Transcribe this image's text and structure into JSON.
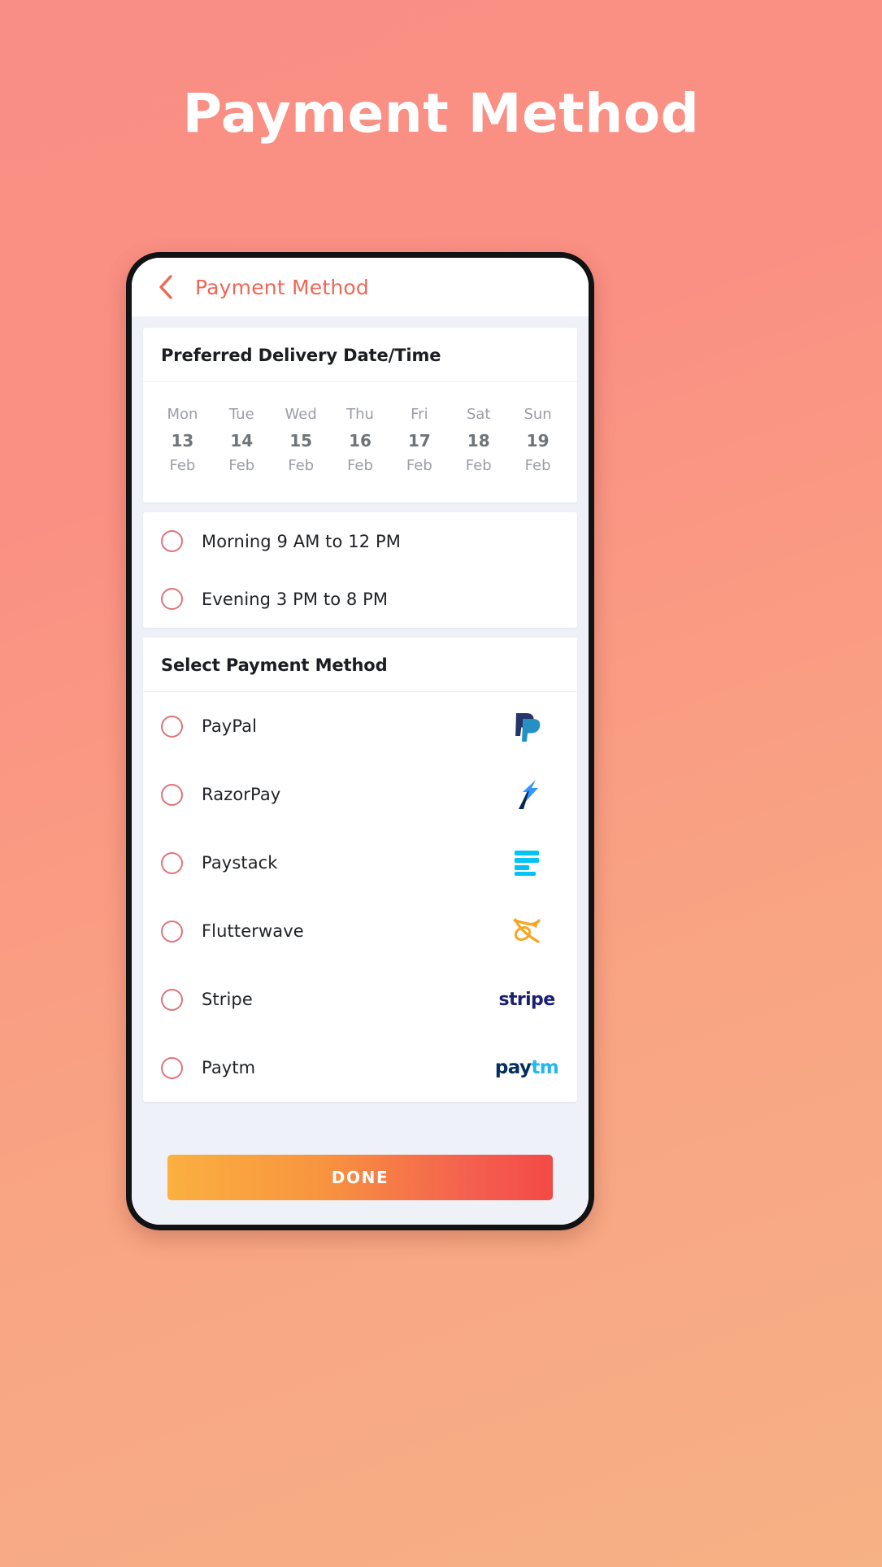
{
  "banner": {
    "title": "Payment Method"
  },
  "appbar": {
    "title": "Payment Method",
    "back_icon": "chevron-left-icon",
    "accent_color": "#ef6755"
  },
  "delivery_card": {
    "header": "Preferred Delivery Date/Time",
    "dates": [
      {
        "dow": "Mon",
        "day": "13",
        "month": "Feb"
      },
      {
        "dow": "Tue",
        "day": "14",
        "month": "Feb"
      },
      {
        "dow": "Wed",
        "day": "15",
        "month": "Feb"
      },
      {
        "dow": "Thu",
        "day": "16",
        "month": "Feb"
      },
      {
        "dow": "Fri",
        "day": "17",
        "month": "Feb"
      },
      {
        "dow": "Sat",
        "day": "18",
        "month": "Feb"
      },
      {
        "dow": "Sun",
        "day": "19",
        "month": "Feb"
      }
    ],
    "time_slots": [
      {
        "label": "Morning 9 AM to 12 PM",
        "selected": false
      },
      {
        "label": "Evening 3 PM to 8 PM",
        "selected": false
      }
    ]
  },
  "payment_card": {
    "header": "Select Payment Method",
    "methods": [
      {
        "label": "PayPal",
        "logo": "paypal-logo",
        "selected": false
      },
      {
        "label": "RazorPay",
        "logo": "razorpay-logo",
        "selected": false
      },
      {
        "label": "Paystack",
        "logo": "paystack-logo",
        "selected": false
      },
      {
        "label": "Flutterwave",
        "logo": "flutterwave-logo",
        "selected": false
      },
      {
        "label": "Stripe",
        "logo": "stripe-logo",
        "selected": false
      },
      {
        "label": "Paytm",
        "logo": "paytm-logo",
        "selected": false
      }
    ]
  },
  "footer": {
    "done_label": "DONE"
  },
  "logo_text": {
    "stripe": "stripe",
    "paytm_pay": "pay",
    "paytm_tm": "tm"
  },
  "colors": {
    "accent": "#ef6755",
    "radio_border": "#e0737a",
    "page_bg_top": "#f98f84",
    "page_bg_bottom": "#f6b184",
    "screen_bg": "#eef1f8",
    "done_gradient_start": "#fbb040",
    "done_gradient_end": "#f34a45"
  }
}
